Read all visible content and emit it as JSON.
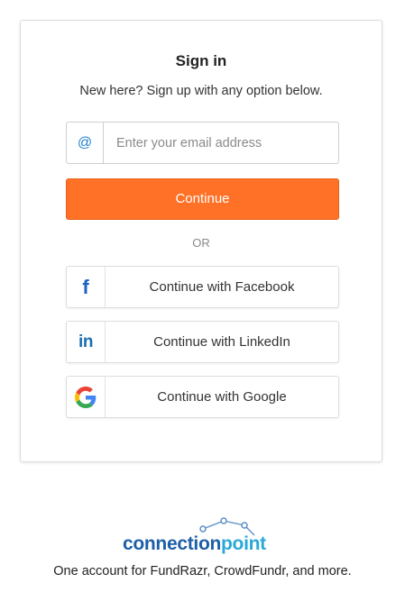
{
  "signin": {
    "title": "Sign in",
    "subtitle": "New here? Sign up with any option below.",
    "email": {
      "prefix": "@",
      "placeholder": "Enter your email address",
      "value": ""
    },
    "continue_label": "Continue",
    "divider": "OR",
    "social": [
      {
        "label": "Continue with Facebook",
        "icon": "facebook-icon"
      },
      {
        "label": "Continue with LinkedIn",
        "icon": "linkedin-icon"
      },
      {
        "label": "Continue with Google",
        "icon": "google-icon"
      }
    ]
  },
  "footer": {
    "logo_text": "connectionpoint",
    "tagline": "One account for FundRazr, CrowdFundr, and more."
  },
  "colors": {
    "accent": "#ff7126",
    "facebook": "#1b63c5",
    "linkedin": "#1c6fb0",
    "logo_blue": "#1d5ea8",
    "logo_cyan": "#29a8d8"
  }
}
